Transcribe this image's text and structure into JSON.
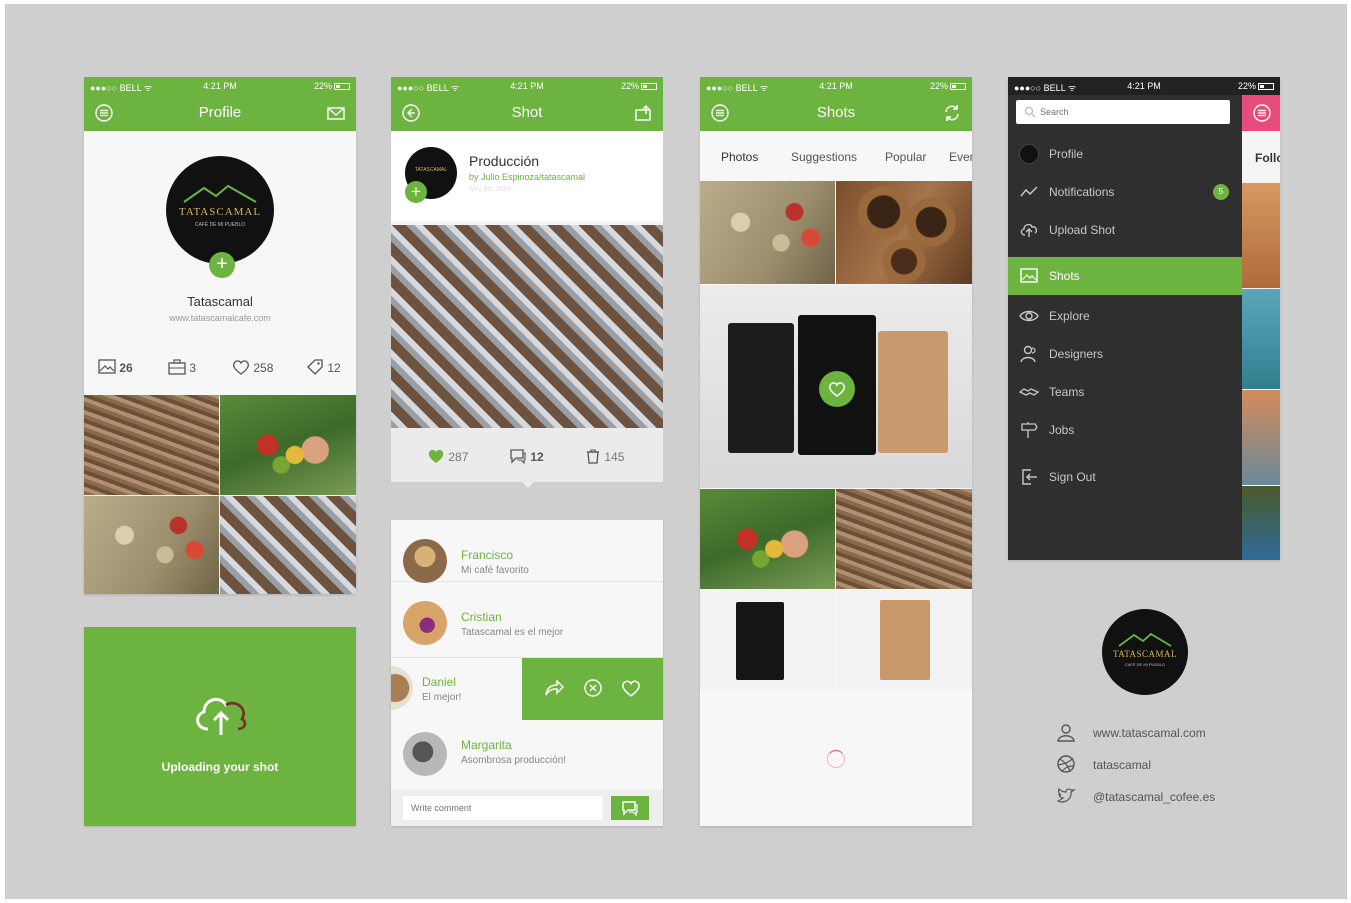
{
  "status": {
    "carrier": "●●●○○ BELL ᯤ",
    "time": "4:21 PM",
    "battery": "22%"
  },
  "colors": {
    "accent": "#6db33f",
    "dark": "#2f2f2f",
    "pink": "#e84c7c"
  },
  "profile": {
    "title": "Profile",
    "brand": "TATASCAMAL",
    "brand_sub": "CAFÉ DE MI PUEBLO",
    "name": "Tatascamal",
    "website": "www.tatascamalcafe.com",
    "stats": [
      "26",
      "3",
      "258",
      "12"
    ]
  },
  "upload": {
    "label": "Uploading your shot"
  },
  "shot": {
    "title": "Shot",
    "post_title": "Producción",
    "post_by": "by Julio Espinoza/tatascamal",
    "post_date": "Nov 10, 2014",
    "likes": "287",
    "comments": "12",
    "buckets": "145"
  },
  "comments": [
    {
      "name": "Francisco",
      "text": "Mi café favorito"
    },
    {
      "name": "Cristian",
      "text": "Tatascamal es el mejor"
    },
    {
      "name": "Daniel",
      "text": "El mejor!"
    },
    {
      "name": "Margarita",
      "text": "Asombrosa producción!"
    }
  ],
  "comment_input": {
    "placeholder": "Write comment"
  },
  "shots": {
    "title": "Shots",
    "tabs": [
      "Photos",
      "Suggestions",
      "Popular",
      "Ever"
    ]
  },
  "menu": {
    "search_placeholder": "Search",
    "items": [
      {
        "label": "Profile",
        "icon": "avatar-icon"
      },
      {
        "label": "Notifications",
        "icon": "activity-icon",
        "badge": "5"
      },
      {
        "label": "Upload Shot",
        "icon": "cloud-upload-icon"
      },
      {
        "label": "Shots",
        "icon": "image-icon",
        "active": true
      },
      {
        "label": "Explore",
        "icon": "eye-icon"
      },
      {
        "label": "Designers",
        "icon": "users-icon"
      },
      {
        "label": "Teams",
        "icon": "handshake-icon"
      },
      {
        "label": "Jobs",
        "icon": "sign-icon"
      },
      {
        "label": "Sign Out",
        "icon": "sign-out-icon"
      }
    ],
    "peek_label": "Follo"
  },
  "contact": {
    "website": "www.tatascamal.com",
    "dribbble": "tatascamal",
    "twitter": "@tatascamal_cofee.es"
  }
}
